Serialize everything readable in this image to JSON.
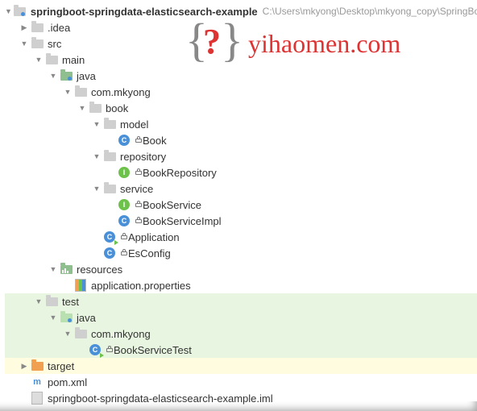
{
  "logo_text": "yihaomen.com",
  "root": {
    "name": "springboot-springdata-elasticsearch-example",
    "path": "C:\\Users\\mkyong\\Desktop\\mkyong_copy\\SpringBoo"
  },
  "nodes": {
    "idea": ".idea",
    "src": "src",
    "main": "main",
    "java": "java",
    "pkg": "com.mkyong",
    "book": "book",
    "model": "model",
    "book_cls": "Book",
    "repository": "repository",
    "book_repo": "BookRepository",
    "service": "service",
    "book_svc": "BookService",
    "book_svc_impl": "BookServiceImpl",
    "application": "Application",
    "esconfig": "EsConfig",
    "resources": "resources",
    "app_props": "application.properties",
    "test": "test",
    "test_java": "java",
    "test_pkg": "com.mkyong",
    "book_svc_test": "BookServiceTest",
    "target": "target",
    "pom": "pom.xml",
    "iml": "springboot-springdata-elasticsearch-example.iml"
  }
}
